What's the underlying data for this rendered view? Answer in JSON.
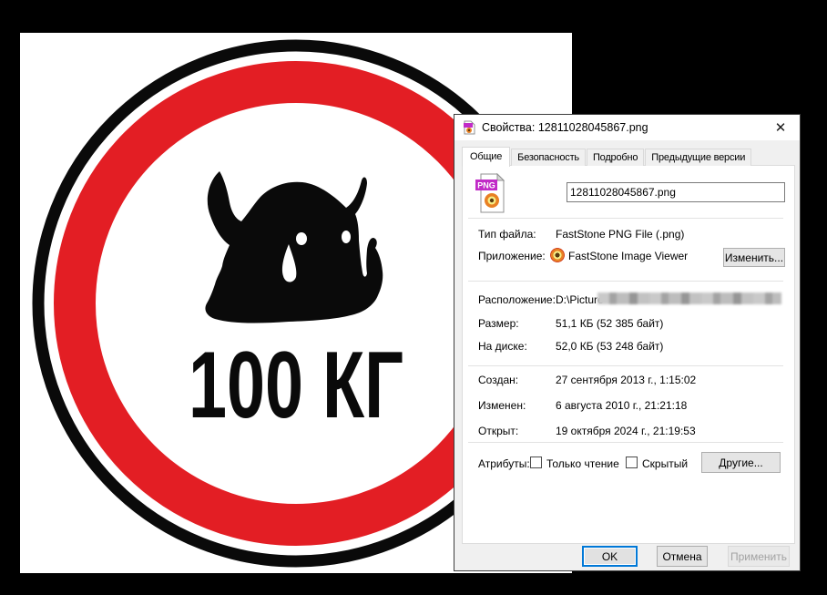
{
  "window": {
    "title": "Свойства: 12811028045867.png",
    "close_glyph": "✕"
  },
  "tabs": [
    {
      "label": "Общие",
      "active": true
    },
    {
      "label": "Безопасность",
      "active": false
    },
    {
      "label": "Подробно",
      "active": false
    },
    {
      "label": "Предыдущие версии",
      "active": false
    }
  ],
  "general": {
    "file_icon_badge": "PNG",
    "file_name": "12811028045867.png",
    "file_type": {
      "label": "Тип файла:",
      "value": "FastStone PNG File (.png)"
    },
    "app": {
      "label": "Приложение:",
      "value": "FastStone Image Viewer",
      "change_button": "Изменить..."
    },
    "location": {
      "label": "Расположение:",
      "value": "D:\\Picture"
    },
    "size": {
      "label": "Размер:",
      "value": "51,1 КБ (52 385 байт)"
    },
    "on_disk": {
      "label": "На диске:",
      "value": "52,0 КБ (53 248 байт)"
    },
    "created": {
      "label": "Создан:",
      "value": "27 сентября 2013 г., 1:15:02"
    },
    "modified": {
      "label": "Изменен:",
      "value": "6 августа 2010 г., 21:21:18"
    },
    "opened": {
      "label": "Открыт:",
      "value": "19 октября 2024 г., 21:19:53"
    },
    "attributes": {
      "label": "Атрибуты:",
      "read_only": "Только чтение",
      "hidden": "Скрытый",
      "other_button": "Другие..."
    }
  },
  "footer": {
    "ok": "OK",
    "cancel": "Отмена",
    "apply": "Применить"
  },
  "sign": {
    "caption": "100 КГ"
  },
  "colors": {
    "accent": "#0078d7",
    "sign_red": "#e31e24",
    "icon_purple": "#c12bc7",
    "icon_orange": "#e88024"
  }
}
